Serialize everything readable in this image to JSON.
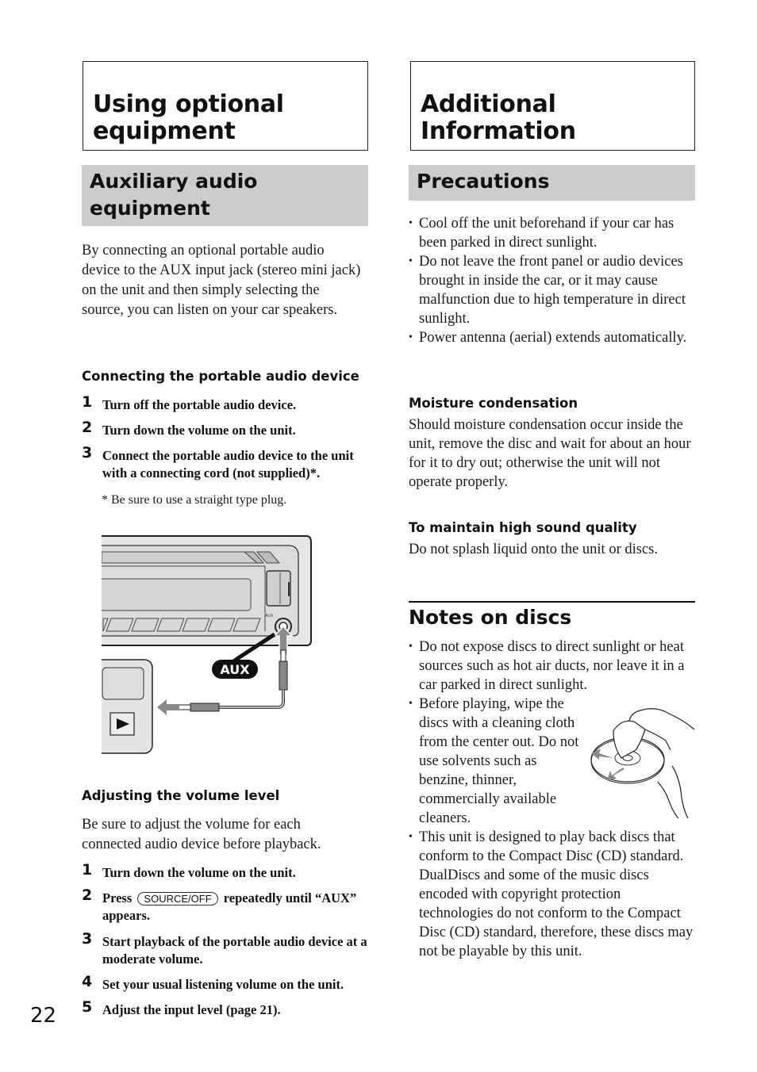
{
  "page_number": "22",
  "left": {
    "chapter_title_line1": "Using optional",
    "chapter_title_line2": "equipment",
    "section_title_line1": "Auxiliary audio",
    "section_title_line2": "equipment",
    "intro": "By connecting an optional portable audio device to the AUX input jack (stereo mini jack) on the unit and then simply selecting the source, you can listen on your car speakers.",
    "connecting": {
      "heading": "Connecting the portable audio device",
      "steps": [
        {
          "num": "1",
          "text": "Turn off the portable audio device."
        },
        {
          "num": "2",
          "text": "Turn down the volume on the unit."
        },
        {
          "num": "3",
          "text": "Connect the portable audio device to the unit with a connecting cord (not supplied)*."
        }
      ],
      "footnote": "*  Be sure to use a straight type plug."
    },
    "figure": {
      "aux_badge": "AUX",
      "aux_jack_label": "AUX",
      "play_icon": "play-icon"
    },
    "adjusting": {
      "heading": "Adjusting the volume level",
      "intro": "Be sure to adjust the volume for each connected audio device before playback.",
      "steps": [
        {
          "num": "1",
          "text": "Turn down the volume on the unit."
        },
        {
          "num": "2",
          "text_before": "Press",
          "button": "SOURCE/OFF",
          "text_after": "repeatedly until “AUX” appears."
        },
        {
          "num": "3",
          "text": "Start playback of the portable audio device at a moderate volume."
        },
        {
          "num": "4",
          "text": "Set your usual listening volume on the unit."
        },
        {
          "num": "5",
          "text": "Adjust the input level (page 21)."
        }
      ]
    }
  },
  "right": {
    "chapter_title_line1": "Additional",
    "chapter_title_line2": "Information",
    "section_title": "Precautions",
    "precautions": [
      "Cool off the unit beforehand if your car has been parked in direct sunlight.",
      "Do not leave the front panel or audio devices brought in inside the car, or it may cause malfunction due to high temperature in direct sunlight.",
      "Power antenna (aerial) extends automatically."
    ],
    "moisture": {
      "heading": "Moisture condensation",
      "text": "Should moisture condensation occur inside the unit, remove the disc and wait for about an hour for it to dry out; otherwise the unit will not operate properly."
    },
    "sound_quality": {
      "heading": "To maintain high sound quality",
      "text": "Do not splash liquid onto the unit or discs."
    },
    "notes_on_discs": {
      "heading": "Notes on discs",
      "items": [
        "Do not expose discs to direct sunlight or heat sources such as hot air ducts, nor leave it in a car parked in direct sunlight.",
        "Before playing, wipe the discs with a cleaning cloth from the center out. Do not use solvents such as benzine, thinner, commercially available cleaners.",
        "This unit is designed to play back discs that conform to the Compact Disc (CD) standard. DualDiscs and some of the music discs encoded with copyright protection technologies do not conform to the Compact Disc (CD) standard, therefore, these discs may not be playable by this unit."
      ]
    }
  }
}
